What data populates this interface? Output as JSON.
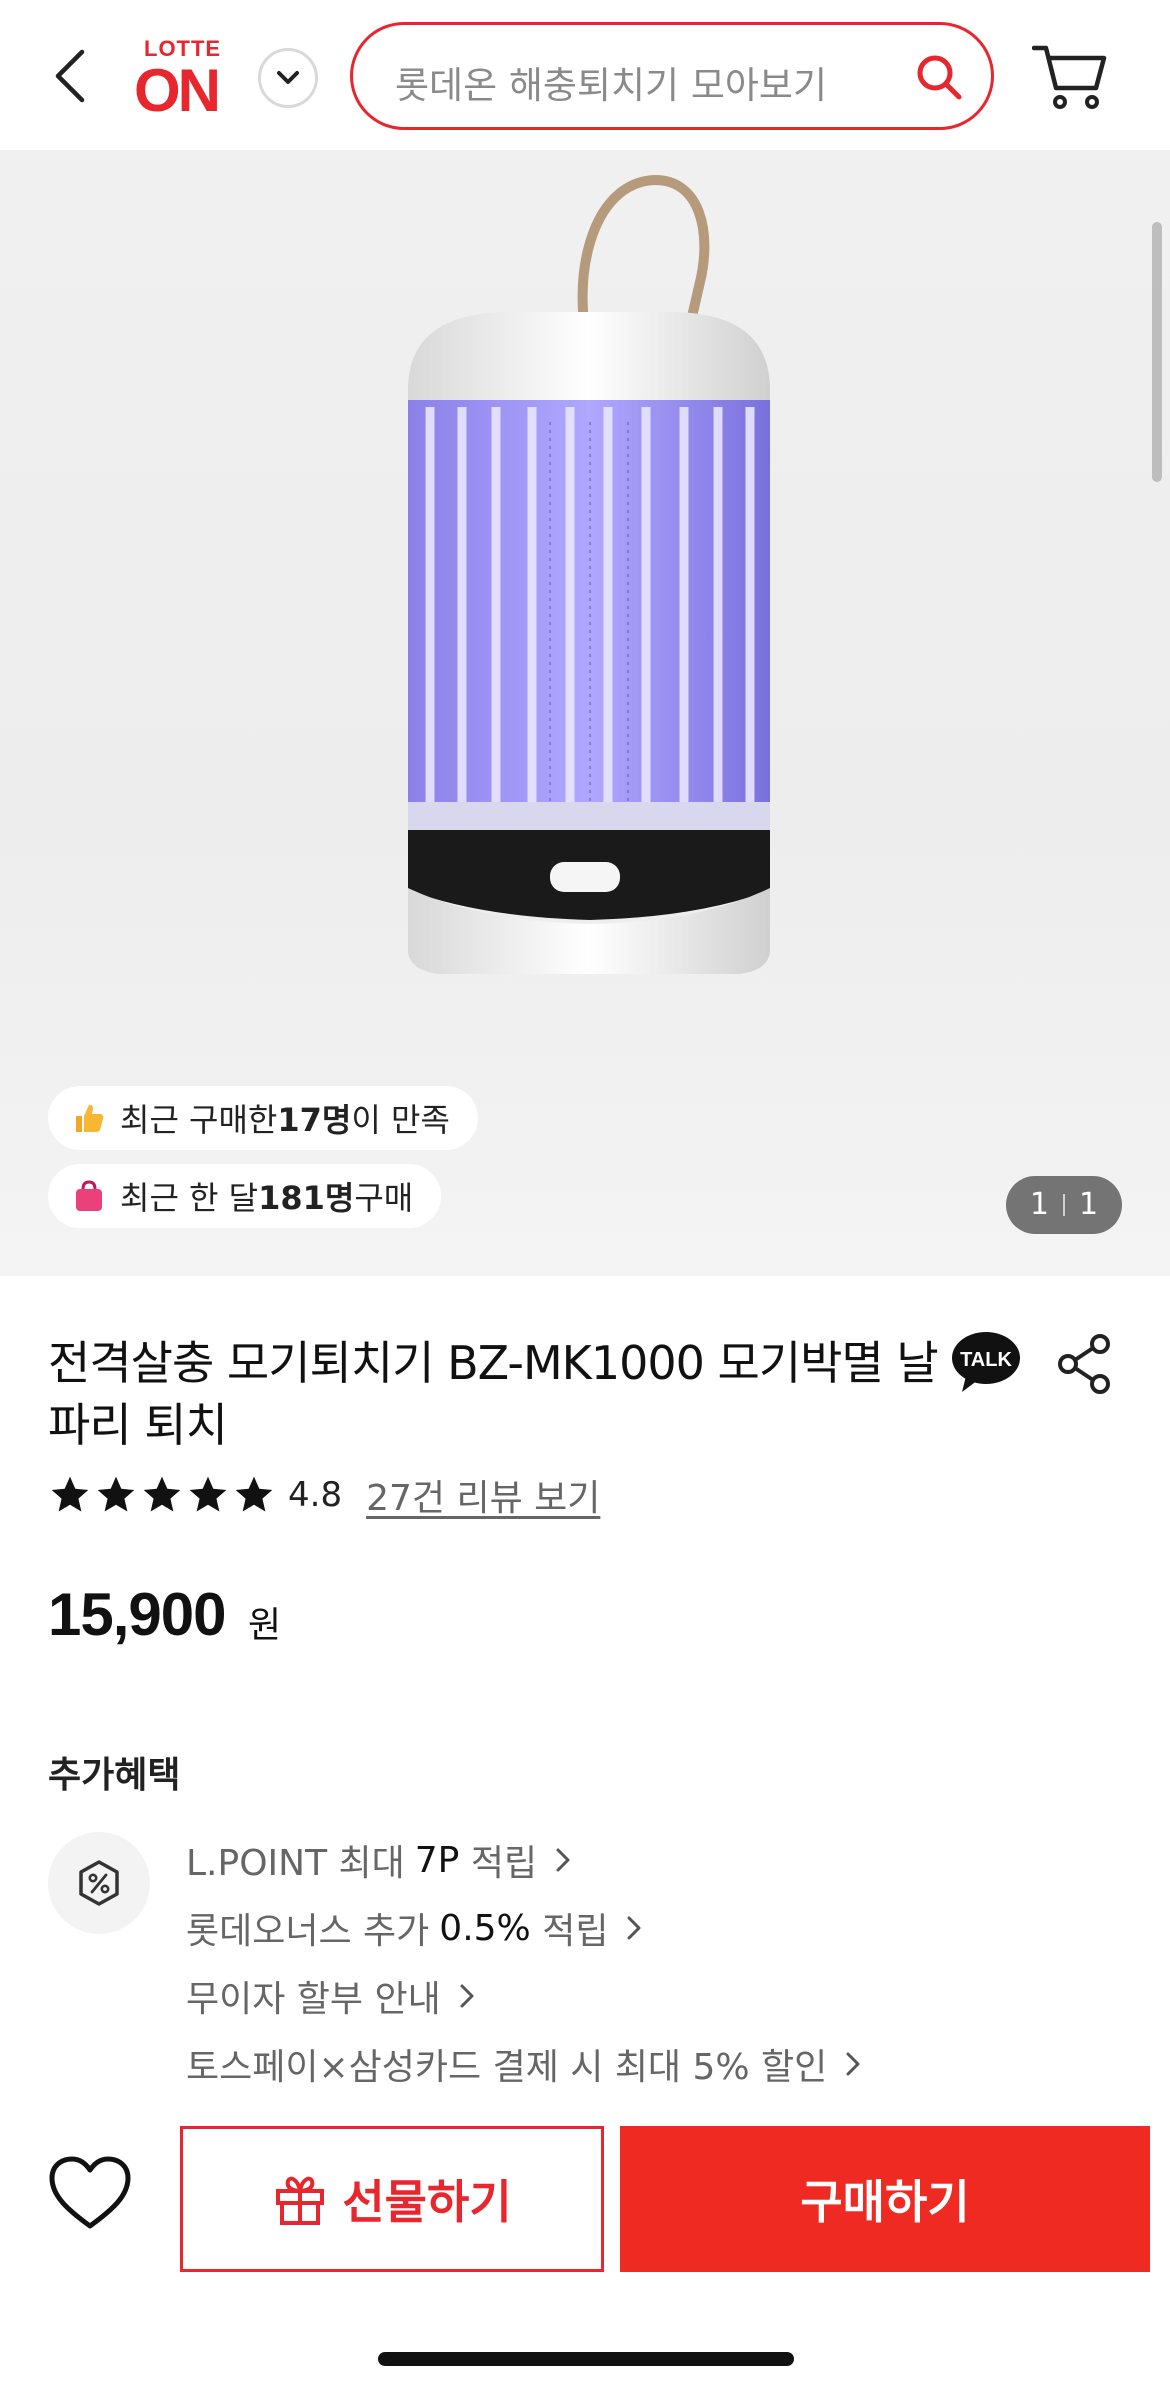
{
  "header": {
    "logo_top": "LOTTE",
    "logo_bottom": "ON",
    "search_placeholder": "롯데온 해충퇴치기 모아보기",
    "icons": [
      "back-icon",
      "chevron-down-icon",
      "search-icon",
      "cart-icon"
    ]
  },
  "hero": {
    "pill_satisfied_pre": "최근 구매한 ",
    "pill_satisfied_count": "17명",
    "pill_satisfied_post": "이 만족",
    "pill_monthly_pre": "최근 한 달 ",
    "pill_monthly_count": "181명",
    "pill_monthly_post": " 구매",
    "image_index": "1",
    "image_total": "1"
  },
  "product": {
    "title": "전격살충 모기퇴치기 BZ-MK1000 모기박멸 날파리 퇴치",
    "rating": "4.8",
    "stars": 5,
    "review_link": "27건 리뷰 보기",
    "price": "15,900",
    "currency": "원"
  },
  "benefits": {
    "title": "추가혜택",
    "items": [
      {
        "pre": "L.POINT 최대",
        "hl": "7P",
        "post": "적립"
      },
      {
        "pre": "롯데오너스 추가",
        "hl": "0.5%",
        "post": "적립"
      },
      {
        "pre": "무이자 할부 안내",
        "hl": "",
        "post": ""
      },
      {
        "pre": "토스페이×삼성카드 결제 시 최대 5% 할인",
        "hl": "",
        "post": ""
      }
    ]
  },
  "bottom_bar": {
    "gift_label": "선물하기",
    "buy_label": "구매하기"
  },
  "colors": {
    "brand_red": "#e8262d",
    "buy_red": "#ee2a23"
  }
}
